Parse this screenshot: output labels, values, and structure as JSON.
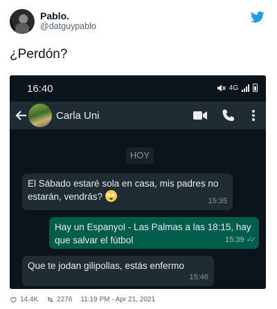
{
  "author": {
    "display_name": "Pablo.",
    "handle": "@datguypablo",
    "avatar": "user-avatar",
    "logo": "twitter-bird-icon"
  },
  "tweet": {
    "text": "¿Perdón?"
  },
  "phone": {
    "status_time": "16:40",
    "network": "4G",
    "contact_name": "Carla Uni",
    "date_chip": "HOY",
    "messages": [
      {
        "direction": "incoming",
        "text": "El Sábado estaré sola en casa, mis padres no estarán, vendrás?",
        "emoji": "flushed-face",
        "time": "15:35"
      },
      {
        "direction": "outgoing",
        "text": "Hay un Espanyol - Las Palmas a las 18:15, hay que salvar el fútbol",
        "time": "15:39",
        "status": "read-double-check"
      },
      {
        "direction": "incoming",
        "text": "Que te jodan gilipollas, estás enfermo",
        "time": "15:46"
      }
    ]
  },
  "footer": {
    "likes": "14.4K",
    "retweets": "2276",
    "timestamp": "11:19 PM - Apr 21, 2021"
  },
  "colors": {
    "twitter_blue": "#1d9bf0",
    "chat_bg": "#0b141a",
    "incoming_bubble": "#1f2c34",
    "outgoing_bubble": "#005c4b",
    "read_ticks": "#53bdeb"
  }
}
